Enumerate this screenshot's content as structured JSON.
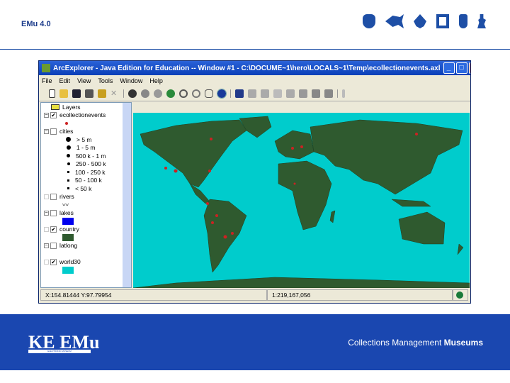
{
  "header": {
    "title": "EMu 4.0",
    "icons": [
      "mask-icon",
      "fish-icon",
      "leaf-icon",
      "frame-icon",
      "vase-icon",
      "statue-icon"
    ]
  },
  "window": {
    "title": "ArcExplorer - Java Edition for Education -- Window #1 - C:\\DOCUME~1\\hero\\LOCALS~1\\Temp\\ecollectionevents.axl",
    "menu": [
      "File",
      "Edit",
      "View",
      "Tools",
      "Window",
      "Help"
    ]
  },
  "legend": {
    "root": "Layers",
    "layers": [
      {
        "name": "ecollectionevents",
        "checked": true
      },
      {
        "name": "cities",
        "checked": false,
        "classes": [
          "> 5 m",
          "1 - 5 m",
          "500 k - 1 m",
          "250 - 500 k",
          "100 - 250 k",
          "50 - 100 k",
          "< 50 k"
        ]
      },
      {
        "name": "rivers",
        "checked": false
      },
      {
        "name": "lakes",
        "checked": false
      },
      {
        "name": "country",
        "checked": true
      },
      {
        "name": "latlong",
        "checked": false
      },
      {
        "name": "world30",
        "checked": true
      }
    ]
  },
  "status": {
    "coords": "X:154.81444 Y:97.79954",
    "scale": "1:219,167,056"
  },
  "colors": {
    "ocean": "#00cccc",
    "land": "#2f5a2f",
    "points": "#cc2222",
    "brand": "#1a47b0"
  },
  "footer": {
    "logo": "KE EMu",
    "logo_sub": "ELECTRONIC MUSEUM",
    "tagline_light": "Collections Management",
    "tagline_bold": "Museums"
  }
}
